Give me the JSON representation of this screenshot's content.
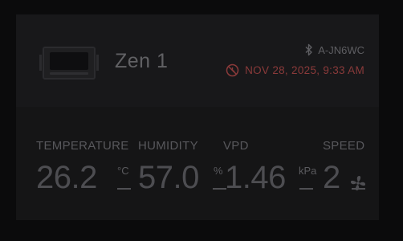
{
  "device": {
    "name": "Zen 1",
    "bluetooth_id": "A-JN6WC",
    "last_seen": "NOV 28, 2025, 9:33 AM"
  },
  "metrics": {
    "temperature": {
      "label": "TEMPERATURE",
      "value": "26.2",
      "unit": "°C"
    },
    "humidity": {
      "label": "HUMIDITY",
      "value": "57.0",
      "unit": "%"
    },
    "vpd": {
      "label": "VPD",
      "value": "1.46",
      "unit": "kPa"
    },
    "speed": {
      "label": "SPEED",
      "value": "2"
    }
  },
  "colors": {
    "background": "#0b0b0c",
    "card": "#151516",
    "header": "#18181a",
    "alert": "#8a3a3a",
    "text_muted": "#58585c"
  },
  "icons": {
    "bluetooth": "bluetooth-icon",
    "offline": "offline-icon",
    "fan": "fan-icon"
  }
}
